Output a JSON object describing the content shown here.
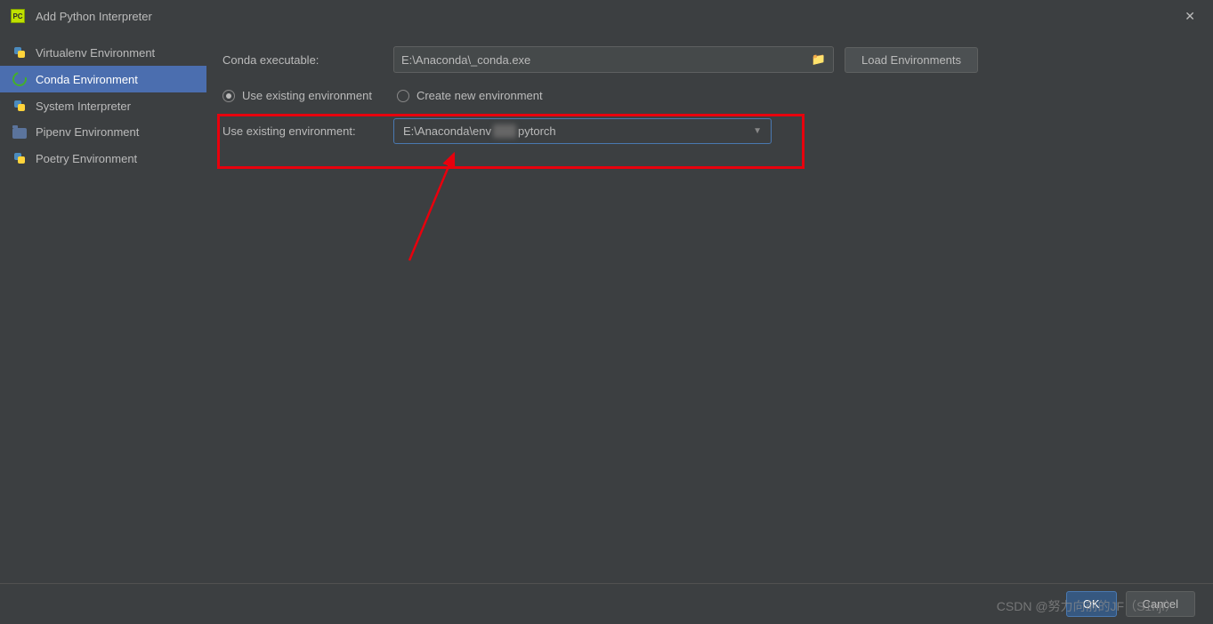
{
  "titlebar": {
    "title": "Add Python Interpreter"
  },
  "sidebar": {
    "items": [
      {
        "label": "Virtualenv Environment",
        "icon": "python"
      },
      {
        "label": "Conda Environment",
        "icon": "conda",
        "selected": true
      },
      {
        "label": "System Interpreter",
        "icon": "python"
      },
      {
        "label": "Pipenv Environment",
        "icon": "folder"
      },
      {
        "label": "Poetry Environment",
        "icon": "python"
      }
    ]
  },
  "main": {
    "conda_exe_label": "Conda executable:",
    "conda_exe_value": "E:\\Anaconda\\_conda.exe",
    "load_env_button": "Load Environments",
    "radio_existing": "Use existing environment",
    "radio_create": "Create new environment",
    "use_existing_label": "Use existing environment:",
    "env_dropdown_value_prefix": "E:\\Anaconda\\env",
    "env_dropdown_value_blurred": "xxxx",
    "env_dropdown_value_suffix": "pytorch"
  },
  "footer": {
    "ok": "OK",
    "cancel": "Cancel"
  },
  "watermark": "CSDN @努力向前的JF（S1hjf）"
}
